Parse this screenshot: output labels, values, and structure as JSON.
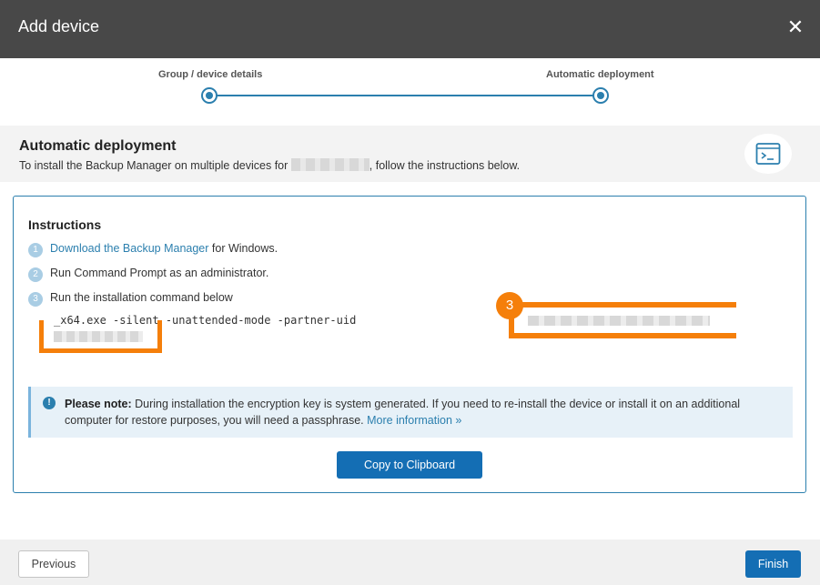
{
  "dialog": {
    "title": "Add device",
    "close_icon": "close-icon",
    "close_glyph": "✕"
  },
  "stepper": {
    "steps": [
      {
        "label": "Group / device details"
      },
      {
        "label": "Automatic deployment"
      }
    ]
  },
  "section": {
    "heading": "Automatic deployment",
    "subtitle_before": "To install the Backup Manager on multiple devices for ",
    "subtitle_after": ", follow the instructions below.",
    "icon": "terminal-icon"
  },
  "instructions": {
    "title": "Instructions",
    "items": [
      {
        "number": "1",
        "link": "Download the Backup Manager",
        "text": " for Windows."
      },
      {
        "number": "2",
        "text": "Run Command Prompt as an administrator."
      },
      {
        "number": "3",
        "text": "Run the installation command below"
      }
    ],
    "command": "          _x64.exe -silent -unattended-mode -partner-uid",
    "annotation_badge": "3"
  },
  "note": {
    "icon": "info-icon",
    "icon_glyph": "!",
    "label": "Please note:",
    "text": " During installation the encryption key is system generated. If you need to re-install the device or install it on an additional computer for restore purposes, you will need a passphrase. ",
    "link": "More information »"
  },
  "buttons": {
    "copy": "Copy to Clipboard",
    "previous": "Previous",
    "finish": "Finish"
  },
  "colors": {
    "accent": "#146eb4",
    "highlight": "#f57f0a",
    "titlebar": "#484848"
  }
}
